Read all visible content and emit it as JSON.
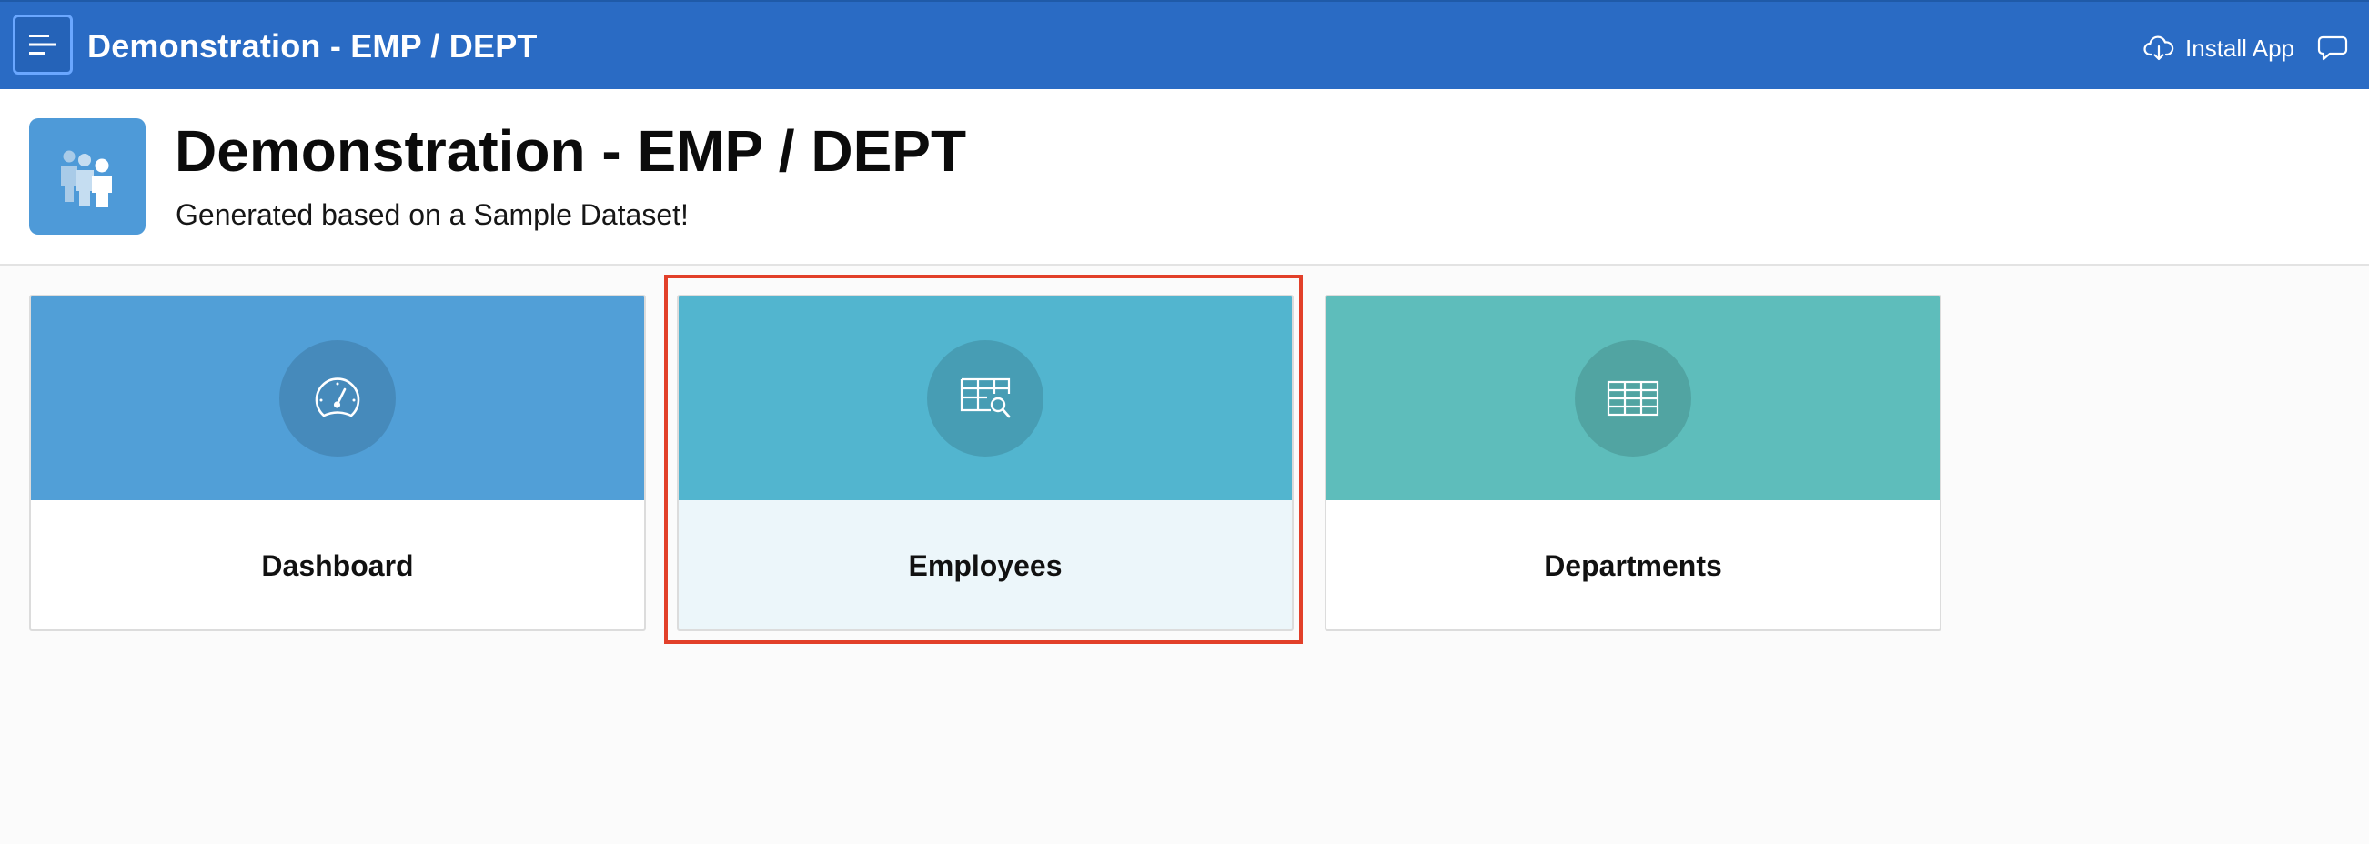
{
  "topbar": {
    "title": "Demonstration - EMP / DEPT",
    "install_app_label": "Install App",
    "menu_icon": "hamburger-menu-icon",
    "install_icon": "cloud-download-icon",
    "feedback_icon": "chat-bubble-icon",
    "background_color": "#2a6bc4"
  },
  "hero": {
    "title": "Demonstration - EMP / DEPT",
    "subtitle": "Generated based on a Sample Dataset!",
    "icon": "users-group-icon",
    "icon_background": "#4e9ad8"
  },
  "cards": [
    {
      "label": "Dashboard",
      "icon": "speedometer-icon",
      "color": "#519fd7",
      "selected": false
    },
    {
      "label": "Employees",
      "icon": "table-search-icon",
      "color": "#52b5cf",
      "selected": true
    },
    {
      "label": "Departments",
      "icon": "table-grid-icon",
      "color": "#5ebdbb",
      "selected": false
    }
  ],
  "highlight": {
    "color": "#e2402a"
  }
}
